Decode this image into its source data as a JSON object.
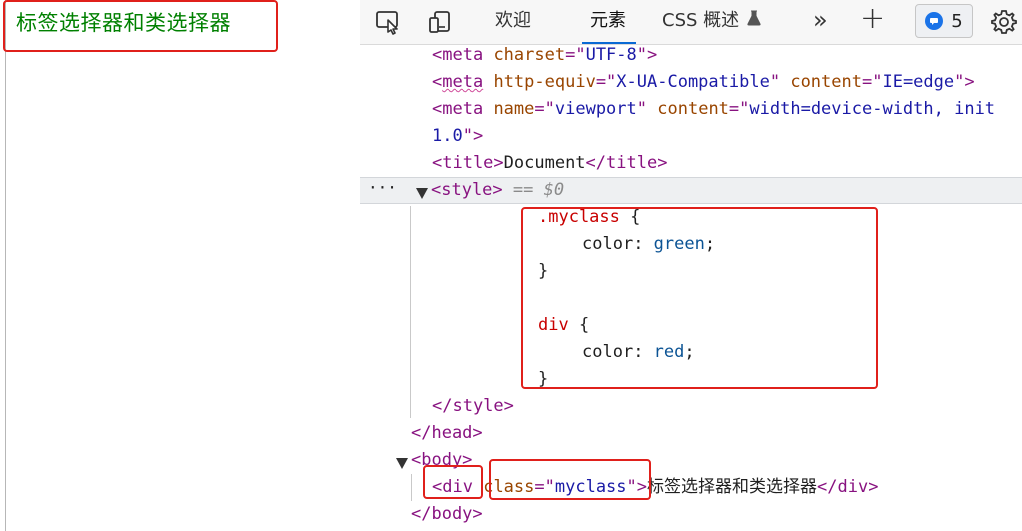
{
  "page": {
    "text": "标签选择器和类选择器",
    "text_color": "#008000"
  },
  "toolbar": {
    "inspect_icon": "inspect-element-icon",
    "device_icon": "device-toolbar-icon",
    "tabs": [
      {
        "label": "欢迎",
        "active": false
      },
      {
        "label": "元素",
        "active": true
      },
      {
        "label": "CSS 概述",
        "active": false
      }
    ],
    "more_tabs": "»",
    "add_tab": "+",
    "issues_count": "5",
    "settings_icon": "gear-icon"
  },
  "tree": {
    "meta_charset": {
      "tag_open": "<meta",
      "attr": "charset",
      "eq": "=\"",
      "val": "UTF-8",
      "close": "\">"
    },
    "meta_compat": {
      "tag_open": "<meta",
      "attr1": "http-equiv",
      "val1": "X-UA-Compatible",
      "attr2": "content",
      "val2": "IE=edge",
      "close": "\">"
    },
    "meta_viewport": {
      "tag_open": "<meta",
      "attr1": "name",
      "val1": "viewport",
      "attr2": "content",
      "val2": "width=device-width, init",
      "cont": "1.0",
      "close": "\">"
    },
    "title": {
      "open": "<title>",
      "text": "Document",
      "close": "</title>"
    },
    "style_open": {
      "tag": "<style>",
      "hint": "== $0",
      "ellipsis": "···"
    },
    "css": {
      "rule1_selector": ".myclass",
      "rule1_prop": "color",
      "rule1_value": "green",
      "rule2_selector": "div",
      "rule2_prop": "color",
      "rule2_value": "red",
      "brace_open": "{",
      "brace_close": "}"
    },
    "style_close": "</style>",
    "head_close": "</head>",
    "body_open": "<body>",
    "div_line": {
      "open": "<div",
      "attr": "class",
      "val": "myclass",
      "text": "标签选择器和类选择器",
      "close": "</div>"
    },
    "body_close": "</body>"
  },
  "colors": {
    "highlight": "#e0201b",
    "accent": "#0a6ad4"
  }
}
